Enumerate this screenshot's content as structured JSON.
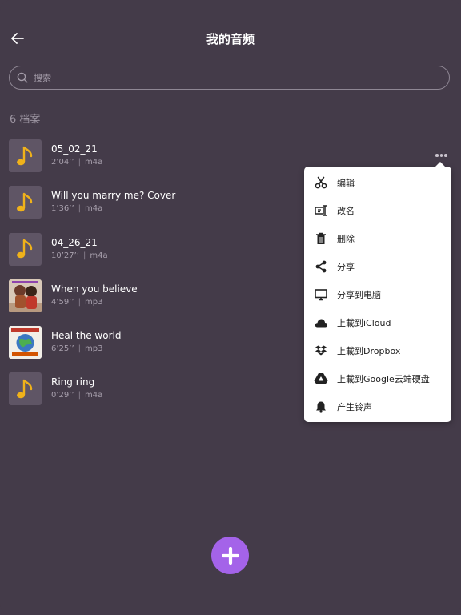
{
  "header": {
    "title": "我的音频"
  },
  "search": {
    "placeholder": "搜索"
  },
  "file_count": "6 档案",
  "files": [
    {
      "title": "05_02_21",
      "duration": "2’04’’",
      "format": "m4a",
      "thumb": "music-note-icon"
    },
    {
      "title": "Will you marry me? Cover",
      "duration": "1’36’’",
      "format": "m4a",
      "thumb": "music-note-icon"
    },
    {
      "title": "04_26_21",
      "duration": "10’27’’",
      "format": "m4a",
      "thumb": "music-note-icon"
    },
    {
      "title": "When you believe",
      "duration": "4’59’’",
      "format": "mp3",
      "thumb": "album-art"
    },
    {
      "title": "Heal the world",
      "duration": "6’25’’",
      "format": "mp3",
      "thumb": "album-art"
    },
    {
      "title": "Ring ring",
      "duration": "0’29’’",
      "format": "m4a",
      "thumb": "music-note-icon"
    }
  ],
  "menu": {
    "items": [
      {
        "label": "编辑",
        "icon": "scissors-icon"
      },
      {
        "label": "改名",
        "icon": "rename-icon"
      },
      {
        "label": "删除",
        "icon": "trash-icon"
      },
      {
        "label": "分享",
        "icon": "share-icon"
      },
      {
        "label": "分享到电脑",
        "icon": "monitor-icon"
      },
      {
        "label": "上載到iCloud",
        "icon": "cloud-icon"
      },
      {
        "label": "上載到Dropbox",
        "icon": "dropbox-icon"
      },
      {
        "label": "上載到Google云端硬盘",
        "icon": "google-drive-icon"
      },
      {
        "label": "产生铃声",
        "icon": "bell-icon"
      }
    ]
  },
  "colors": {
    "background": "#443b49",
    "accent": "#a463e9",
    "note": "#f0b21a",
    "menu_bg": "#ffffff"
  }
}
